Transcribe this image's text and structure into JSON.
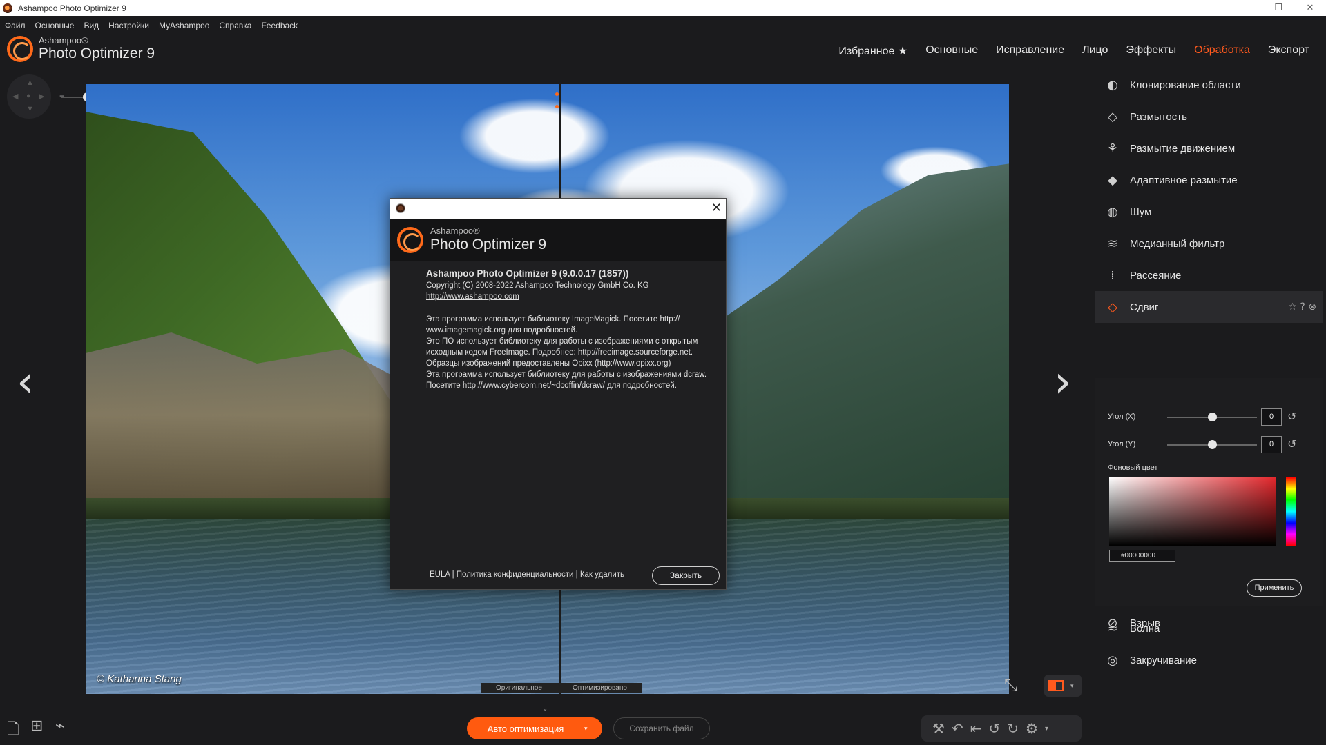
{
  "window": {
    "title": "Ashampoo Photo Optimizer 9",
    "minimize": "—",
    "restore": "❐",
    "close": "✕"
  },
  "menu": [
    "Файл",
    "Основные",
    "Вид",
    "Настройки",
    "MyAshampoo",
    "Справка",
    "Feedback"
  ],
  "logo": {
    "brand": "Ashampoo®",
    "product": "Photo Optimizer 9"
  },
  "tabs": [
    {
      "label": "Избранное ★",
      "active": false
    },
    {
      "label": "Основные",
      "active": false
    },
    {
      "label": "Исправление",
      "active": false
    },
    {
      "label": "Лицо",
      "active": false
    },
    {
      "label": "Эффекты",
      "active": false
    },
    {
      "label": "Обработка",
      "active": true
    },
    {
      "label": "Экспорт",
      "active": false
    }
  ],
  "zoom": {
    "minus": "−",
    "plus": "+",
    "level": 0.31
  },
  "photo": {
    "credit": "© Katharina Stang",
    "label_original": "Оригинальное",
    "label_optimized": "Оптимизировано",
    "prev_arrow": "‹",
    "next_arrow": "›"
  },
  "dialog": {
    "brand": "Ashampoo®",
    "product": "Photo Optimizer 9",
    "version_line": "Ashampoo Photo Optimizer 9 (9.0.0.17 (1857))",
    "copyright": "Copyright (C) 2008-2022 Ashampoo Technology GmbH Co. KG",
    "website": "http://www.ashampoo.com",
    "credits": [
      "Эта программа использует библиотеку ImageMagick. Посетите http://",
      "www.imagemagick.org для подробностей.",
      "Это ПО использует библиотеку для работы с изображениями с открытым",
      "исходным кодом FreeImage. Подробнее: http://freeimage.sourceforge.net.",
      "Образцы изображений предоставлены Opixx (http://www.opixx.org)",
      "Эта программа использует библиотеку для работы с изображениями dcraw.",
      "Посетите http://www.cybercom.net/~dcoffin/dcraw/ для подробностей."
    ],
    "footer_links": "EULA | Политика конфиденциальности | Как удалить",
    "close_button": "Закрыть",
    "close_x": "✕"
  },
  "filters_top": [
    {
      "label": "Клонирование области",
      "icon": "clone-icon",
      "glyph": "◐"
    },
    {
      "label": "Размытость",
      "icon": "blur-drop-icon",
      "glyph": "◇"
    },
    {
      "label": "Размытие движением",
      "icon": "motion-blur-icon",
      "glyph": "⚘"
    },
    {
      "label": "Адаптивное размытие",
      "icon": "adaptive-blur-icon",
      "glyph": "◆"
    },
    {
      "label": "Шум",
      "icon": "noise-globe-icon",
      "glyph": "◍"
    },
    {
      "label": "Медианный фильтр",
      "icon": "median-filter-icon",
      "glyph": "≋"
    },
    {
      "label": "Рассеяние",
      "icon": "scatter-icon",
      "glyph": "⁞"
    }
  ],
  "active_filter": {
    "label": "Сдвиг",
    "icon": "shift-diamond-icon",
    "glyph": "◇",
    "tools": "☆ ? ⊗"
  },
  "params": {
    "angle_x_label": "Угол (X)",
    "angle_x_value": "0",
    "angle_y_label": "Угол (Y)",
    "angle_y_value": "0",
    "bg_color_label": "Фоновый цвет",
    "hex_value": "#00000000",
    "apply_button": "Применить",
    "reset_glyph": "↺"
  },
  "filters_bottom": [
    {
      "label": "Волна",
      "icon": "wave-icon",
      "glyph": "≈"
    },
    {
      "label": "Закручивание",
      "icon": "swirl-icon",
      "glyph": "◎"
    },
    {
      "label": "Взрыв",
      "icon": "explosion-icon",
      "glyph": "⊘"
    }
  ],
  "bottom": {
    "auto_optimize": "Авто оптимизация",
    "save_file": "Сохранить файл",
    "dropdown": "▾"
  },
  "colors": {
    "accent": "#ff5a1e",
    "background": "#1b1b1d"
  }
}
